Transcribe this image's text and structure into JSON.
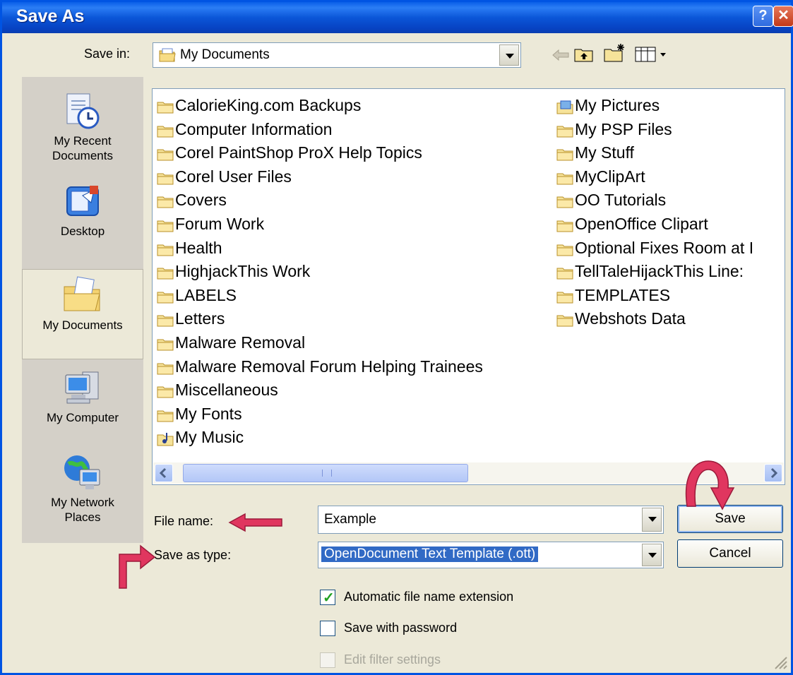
{
  "title": "Save As",
  "title_buttons": {
    "help": "?",
    "close": "✕"
  },
  "save_in": {
    "label": "Save in:",
    "value": "My Documents"
  },
  "toolbar_icons": [
    "back-arrow-icon",
    "up-folder-icon",
    "new-folder-icon",
    "view-menu-icon"
  ],
  "places": [
    {
      "label": "My Recent\nDocuments",
      "icon": "recent-documents-icon"
    },
    {
      "label": "Desktop",
      "icon": "desktop-icon"
    },
    {
      "label": "My Documents",
      "icon": "my-documents-icon",
      "selected": true
    },
    {
      "label": "My Computer",
      "icon": "my-computer-icon"
    },
    {
      "label": "My Network\nPlaces",
      "icon": "network-places-icon"
    }
  ],
  "files_col1": [
    "CalorieKing.com Backups",
    "Computer Information",
    "Corel PaintShop ProX Help Topics",
    "Corel User Files",
    "Covers",
    "Forum Work",
    "Health",
    "HighjackThis Work",
    "LABELS",
    "Letters",
    "Malware Removal",
    "Malware Removal Forum Helping Trainees",
    "Miscellaneous",
    "My Fonts",
    "My Music"
  ],
  "files_col2": [
    "My Pictures",
    "My PSP Files",
    "My Stuff",
    "MyClipArt",
    "OO Tutorials",
    "OpenOffice Clipart",
    "Optional Fixes Room at I",
    "TellTaleHijackThis Line:",
    "TEMPLATES",
    "Webshots Data"
  ],
  "file_name": {
    "label": "File name:",
    "value": "Example"
  },
  "save_as_type": {
    "label": "Save as type:",
    "value": "OpenDocument Text Template (.ott)"
  },
  "buttons": {
    "save": "Save",
    "cancel": "Cancel"
  },
  "options": [
    {
      "label": "Automatic file name extension",
      "checked": true,
      "enabled": true
    },
    {
      "label": "Save with password",
      "checked": false,
      "enabled": true
    },
    {
      "label": "Edit filter settings",
      "checked": false,
      "enabled": false
    }
  ],
  "colors": {
    "title_bar": "#0a56d8",
    "dialog_bg": "#ece9d8",
    "selection": "#316ac5",
    "annotation_arrow": "#e0365f"
  }
}
